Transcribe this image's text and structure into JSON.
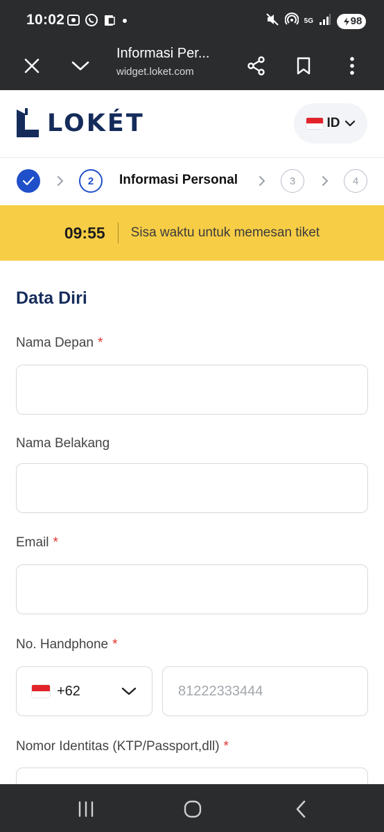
{
  "status_bar": {
    "time": "10:02",
    "network": "5G",
    "battery": "98",
    "icons": [
      "screenshot-icon",
      "whatsapp-icon",
      "clipboard-icon",
      "dot-icon",
      "mute-icon",
      "hotspot-icon",
      "signal-icon",
      "battery-icon"
    ]
  },
  "browser": {
    "page_title": "Informasi Per...",
    "url": "widget.loket.com",
    "icons": [
      "close-icon",
      "chevron-down-icon",
      "share-icon",
      "bookmark-icon",
      "more-vertical-icon"
    ]
  },
  "header": {
    "logo_text": "LOKÉT",
    "language": "ID",
    "brand_color": "#152c5b"
  },
  "stepper": {
    "current_label": "Informasi Personal",
    "steps": [
      "1",
      "2",
      "3",
      "4"
    ],
    "active_color": "#1f4fc9"
  },
  "timer": {
    "value": "09:55",
    "text": "Sisa waktu untuk memesan tiket",
    "background": "#f7cd45"
  },
  "form": {
    "section_title": "Data Diri",
    "required_marker": "*",
    "fields": {
      "first_name": {
        "label": "Nama Depan",
        "value": "",
        "placeholder": ""
      },
      "last_name": {
        "label": "Nama Belakang",
        "value": "",
        "placeholder": ""
      },
      "email": {
        "label": "Email",
        "value": "",
        "placeholder": ""
      },
      "phone": {
        "label": "No. Handphone",
        "country_code": "+62",
        "value": "",
        "placeholder": "81222333444"
      },
      "identity": {
        "label": "Nomor Identitas (KTP/Passport,dll)"
      }
    }
  },
  "nav_bar": {
    "icons": [
      "recents-icon",
      "home-icon",
      "back-icon"
    ]
  }
}
